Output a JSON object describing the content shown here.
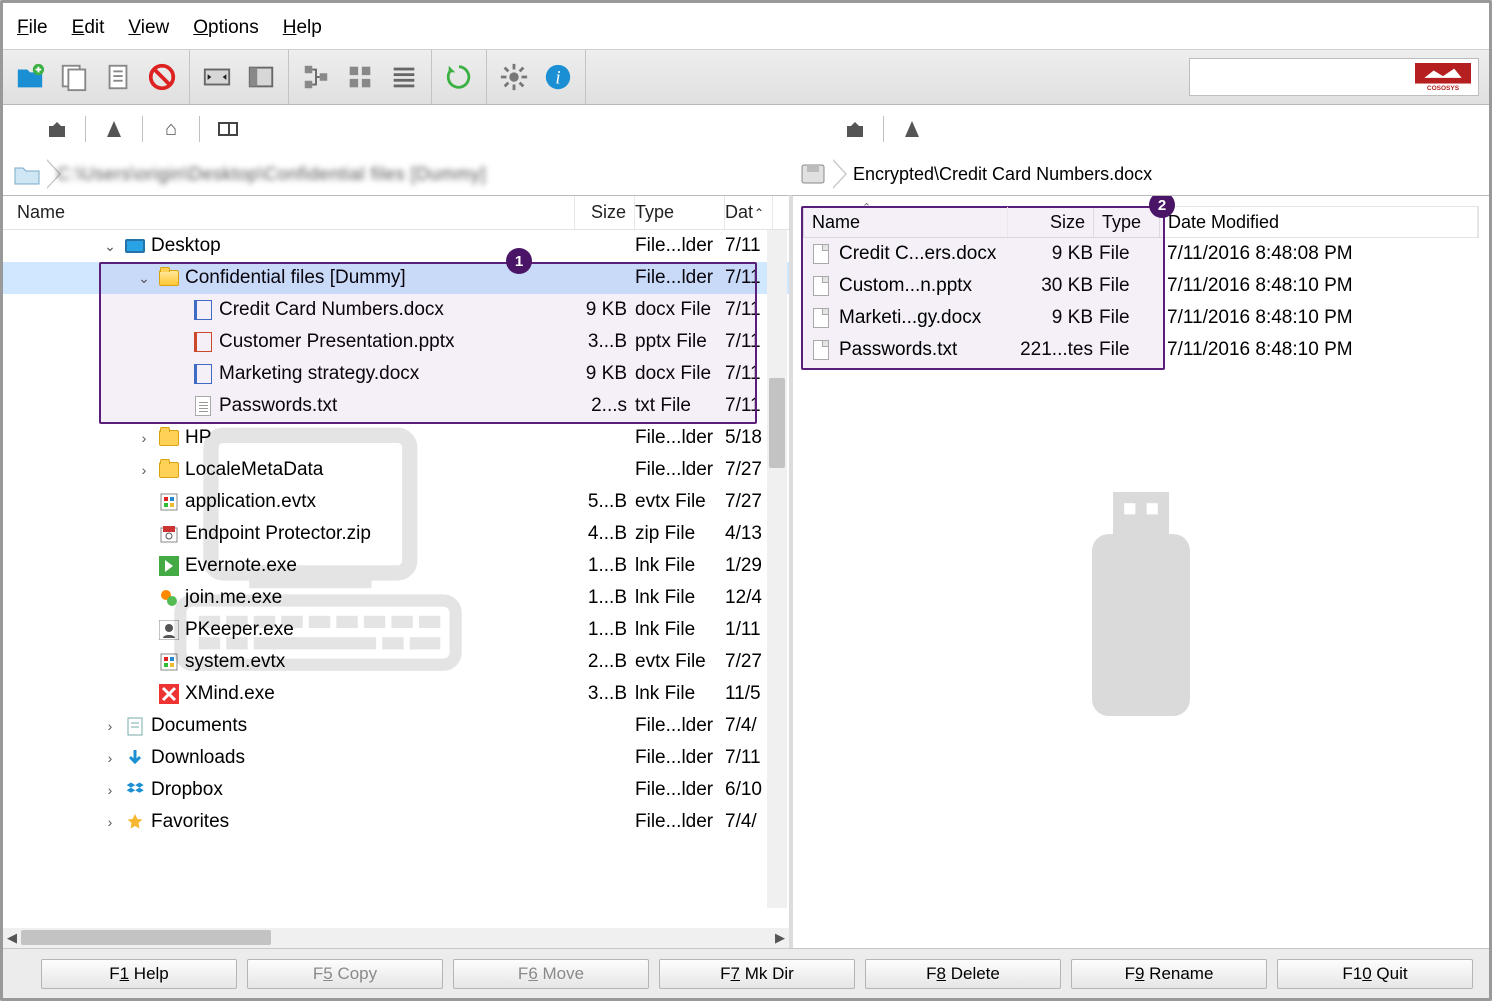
{
  "menu": {
    "file": "File",
    "edit": "Edit",
    "view": "View",
    "options": "Options",
    "help": "Help"
  },
  "breadcrumb_left_blur": "C:\\Users\\origin\\Desktop\\Confidential files [Dummy]",
  "breadcrumb_right": "Encrypted\\Credit Card Numbers.docx",
  "left_columns": {
    "name": "Name",
    "size": "Size",
    "type": "Type",
    "date": "Date"
  },
  "left_rows": [
    {
      "indent": 0,
      "exp": "down",
      "icon": "desktop",
      "name": "Desktop",
      "size": "",
      "type": "File...lder",
      "date": "7/11"
    },
    {
      "indent": 1,
      "exp": "down",
      "icon": "folder-open",
      "name": "Confidential files [Dummy]",
      "size": "",
      "type": "File...lder",
      "date": "7/11",
      "selected": true
    },
    {
      "indent": 2,
      "exp": "none",
      "icon": "doc",
      "name": "Credit Card Numbers.docx",
      "size": "9 KB",
      "type": "docx File",
      "date": "7/11"
    },
    {
      "indent": 2,
      "exp": "none",
      "icon": "ppt",
      "name": "Customer Presentation.pptx",
      "size": "3...B",
      "type": "pptx File",
      "date": "7/11"
    },
    {
      "indent": 2,
      "exp": "none",
      "icon": "doc",
      "name": "Marketing strategy.docx",
      "size": "9 KB",
      "type": "docx File",
      "date": "7/11"
    },
    {
      "indent": 2,
      "exp": "none",
      "icon": "txt",
      "name": "Passwords.txt",
      "size": "2...s",
      "type": "txt File",
      "date": "7/11"
    },
    {
      "indent": 1,
      "exp": "right",
      "icon": "folder",
      "name": "HP",
      "size": "",
      "type": "File...lder",
      "date": "5/18"
    },
    {
      "indent": 1,
      "exp": "right",
      "icon": "folder",
      "name": "LocaleMetaData",
      "size": "",
      "type": "File...lder",
      "date": "7/27"
    },
    {
      "indent": 1,
      "exp": "none",
      "icon": "evtx",
      "name": "application.evtx",
      "size": "5...B",
      "type": "evtx File",
      "date": "7/27"
    },
    {
      "indent": 1,
      "exp": "none",
      "icon": "zip",
      "name": "Endpoint Protector.zip",
      "size": "4...B",
      "type": "zip File",
      "date": "4/13"
    },
    {
      "indent": 1,
      "exp": "none",
      "icon": "exe-green",
      "name": "Evernote.exe",
      "size": "1...B",
      "type": "lnk File",
      "date": "1/29"
    },
    {
      "indent": 1,
      "exp": "none",
      "icon": "exe-orange",
      "name": "join.me.exe",
      "size": "1...B",
      "type": "lnk File",
      "date": "12/4"
    },
    {
      "indent": 1,
      "exp": "none",
      "icon": "exe-gray",
      "name": "PKeeper.exe",
      "size": "1...B",
      "type": "lnk File",
      "date": "1/11"
    },
    {
      "indent": 1,
      "exp": "none",
      "icon": "evtx",
      "name": "system.evtx",
      "size": "2...B",
      "type": "evtx File",
      "date": "7/27"
    },
    {
      "indent": 1,
      "exp": "none",
      "icon": "exe-red",
      "name": "XMind.exe",
      "size": "3...B",
      "type": "lnk File",
      "date": "11/5"
    },
    {
      "indent": 0,
      "exp": "right",
      "icon": "documents",
      "name": "Documents",
      "size": "",
      "type": "File...lder",
      "date": "7/4/"
    },
    {
      "indent": 0,
      "exp": "right",
      "icon": "downloads",
      "name": "Downloads",
      "size": "",
      "type": "File...lder",
      "date": "7/11"
    },
    {
      "indent": 0,
      "exp": "right",
      "icon": "dropbox",
      "name": "Dropbox",
      "size": "",
      "type": "File...lder",
      "date": "6/10"
    },
    {
      "indent": 0,
      "exp": "right",
      "icon": "favorites",
      "name": "Favorites",
      "size": "",
      "type": "File...lder",
      "date": "7/4/"
    }
  ],
  "right_columns": {
    "name": "Name",
    "size": "Size",
    "type": "Type",
    "date": "Date Modified"
  },
  "right_rows": [
    {
      "name": "Credit C...ers.docx",
      "size": "9 KB",
      "type": "File",
      "date": "7/11/2016 8:48:08 PM"
    },
    {
      "name": "Custom...n.pptx",
      "size": "30 KB",
      "type": "File",
      "date": "7/11/2016 8:48:10 PM"
    },
    {
      "name": "Marketi...gy.docx",
      "size": "9 KB",
      "type": "File",
      "date": "7/11/2016 8:48:10 PM"
    },
    {
      "name": "Passwords.txt",
      "size": "221...tes",
      "type": "File",
      "date": "7/11/2016 8:48:10 PM"
    }
  ],
  "callouts": {
    "one": "1",
    "two": "2"
  },
  "fn": {
    "help": "F1 Help",
    "copy": "F5 Copy",
    "move": "F6 Move",
    "mkdir": "F7 Mk Dir",
    "delete": "F8 Delete",
    "rename": "F9 Rename",
    "quit": "F10 Quit"
  },
  "brand": "COSOSYS",
  "date_header_trunc": "Dat"
}
